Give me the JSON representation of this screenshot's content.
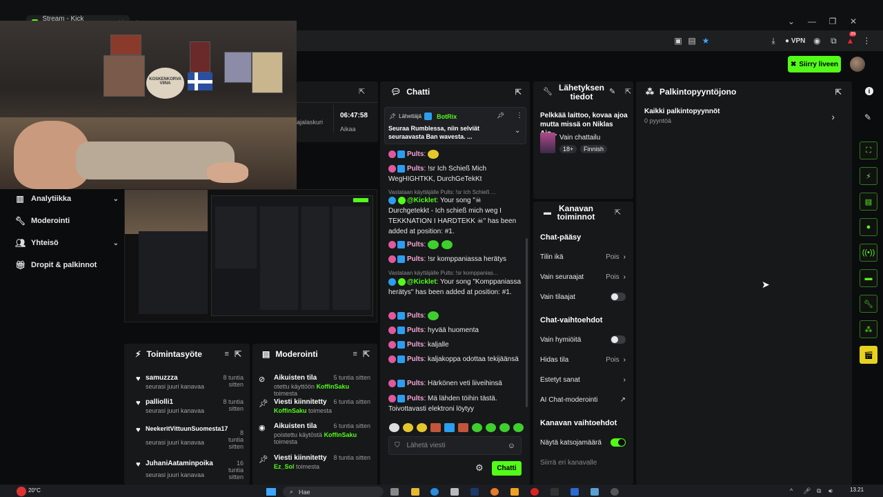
{
  "browser": {
    "tab_title": "Stream - Kick Dashboard",
    "vpn_label": "VPN",
    "notif_count": "39"
  },
  "header": {
    "go_live_label": "Siirry liveen"
  },
  "stream_info_partial": {
    "time": "06:47:58",
    "time_label": "Aikaa",
    "counter_label": "ajalaskuri"
  },
  "nav": {
    "items": [
      {
        "label": "Analytiikka",
        "icon": "chart-icon",
        "chevron": true
      },
      {
        "label": "Moderointi",
        "icon": "wrench-icon",
        "chevron": false
      },
      {
        "label": "Yhteisö",
        "icon": "people-icon",
        "chevron": true
      },
      {
        "label": "Dropit & palkinnot",
        "icon": "gift-icon",
        "chevron": false
      }
    ]
  },
  "webcam": {
    "sign_text_1": "KOSKENKORVA",
    "sign_text_2": "VIINA"
  },
  "activity_feed": {
    "title": "Toimintasyöte",
    "items": [
      {
        "name": "samuzzza",
        "action": "seurasi juuri kanavaa",
        "time": "8 tuntia sitten"
      },
      {
        "name": "palliolli1",
        "action": "seurasi juuri kanavaa",
        "time": "8 tuntia sitten"
      },
      {
        "name": "NeekeritVittuunSuomesta17",
        "action": "seurasi juuri kanavaa",
        "time": "8 tuntia sitten"
      },
      {
        "name": "JuhaniAataminpoika",
        "action": "seurasi juuri kanavaa",
        "time": "16 tuntia sitten"
      }
    ]
  },
  "moderation": {
    "title": "Moderointi",
    "items": [
      {
        "title": "Aikuisten tila",
        "pre": "otettu käyttöön",
        "user": "KoffinSaku",
        "post": "toimesta",
        "time": "5 tuntia sitten",
        "icon": "eye-off-icon"
      },
      {
        "title": "Viesti kiinnitetty",
        "pre": "",
        "user": "KoffinSaku",
        "post": "toimesta",
        "time": "6 tuntia sitten",
        "icon": "pin-icon"
      },
      {
        "title": "Aikuisten tila",
        "pre": "poistettu käytöstä",
        "user": "KoffinSaku",
        "post": "toimesta",
        "time": "6 tuntia sitten",
        "icon": "eye-icon"
      },
      {
        "title": "Viesti kiinnitetty",
        "pre": "",
        "user": "Ez_Sol",
        "post": "toimesta",
        "time": "8 tuntia sitten",
        "icon": "pin-icon"
      }
    ]
  },
  "chat": {
    "title": "Chatti",
    "pinned": {
      "label": "Lähettäjä",
      "user": "BotRix",
      "text": "Seuraa Rumblessa, niin selviät seuraavasta Ban wavesta.",
      "ellipsis": "..."
    },
    "messages": [
      {
        "user": "Pults",
        "text": ""
      },
      {
        "user": "Pults",
        "text": "!sr Ich Schieß Mich WegHIGHTKK, DurchGeTekKt"
      },
      {
        "reply": "Vastataan käyttäjälle Pults: !sr Ich Schieß ...",
        "user": "@Kicklet",
        "text": "Your song \"☠ Durchgetekkt - Ich schieß mich weg I TEKKNATION I HARDTEKK ☠\" has been added at position: #1."
      },
      {
        "user": "Pults",
        "text": ""
      },
      {
        "user": "Pults",
        "text": "!sr komppaniassa herätys"
      },
      {
        "reply": "Vastataan käyttäjälle Pults: !sr komppanias...",
        "user": "@Kicklet",
        "text": "Your song \"Komppaniassa herätys\" has been added at position: #1."
      },
      {
        "user": "Pults",
        "text": ""
      },
      {
        "user": "Pults",
        "text": "hyvää huomenta"
      },
      {
        "user": "Pults",
        "text": "kaljalle"
      },
      {
        "user": "Pults",
        "text": "kaljakoppa odottaa tekijäänsä"
      },
      {
        "user": "Pults",
        "text": "Härkönen veti liiveihinsä"
      },
      {
        "user": "Pults",
        "text": "Mä lähden töihin tästä. Toivottavasti elektroni löytyy"
      }
    ],
    "input_placeholder": "Lähetä viesti",
    "send_label": "Chatti"
  },
  "stream_info": {
    "title": "Lähetyksen tiedot",
    "stream_title": "Pelkkää laittoo, kovaa ajoa mutta missä on Niklas Ajo...",
    "category": "Vain chattailu",
    "tags": [
      "18+",
      "Finnish"
    ]
  },
  "channel_actions": {
    "title": "Kanavan toiminnot",
    "chat_access": {
      "heading": "Chat-pääsy",
      "rows": [
        {
          "label": "Tilin ikä",
          "value": "Pois",
          "kind": "arrow"
        },
        {
          "label": "Vain seuraajat",
          "value": "Pois",
          "kind": "arrow"
        },
        {
          "label": "Vain tilaajat",
          "value": "",
          "kind": "toggle-off"
        }
      ]
    },
    "chat_options": {
      "heading": "Chat-vaihtoehdot",
      "rows": [
        {
          "label": "Vain hymiöitä",
          "value": "",
          "kind": "toggle-off"
        },
        {
          "label": "Hidas tila",
          "value": "Pois",
          "kind": "arrow"
        },
        {
          "label": "Estetyt sanat",
          "value": "",
          "kind": "arrow"
        },
        {
          "label": "AI Chat-moderointi",
          "value": "",
          "kind": "chart"
        }
      ]
    },
    "channel_options": {
      "heading": "Kanavan vaihtoehdot",
      "rows": [
        {
          "label": "Näytä katsojamäärä",
          "value": "",
          "kind": "toggle-on"
        },
        {
          "label": "Siirrä eri kanavalle",
          "value": "",
          "kind": "none"
        }
      ]
    }
  },
  "rewards": {
    "title": "Palkintopyyntöjono",
    "item_title": "Kaikki palkintopyynnöt",
    "item_count": "0 pyyntöä"
  },
  "taskbar": {
    "weather": "20°C",
    "search": "Hae",
    "time": "13.21"
  },
  "colors": {
    "accent": "#53fc18",
    "panel": "#17181a",
    "background": "#0b0c0d"
  }
}
